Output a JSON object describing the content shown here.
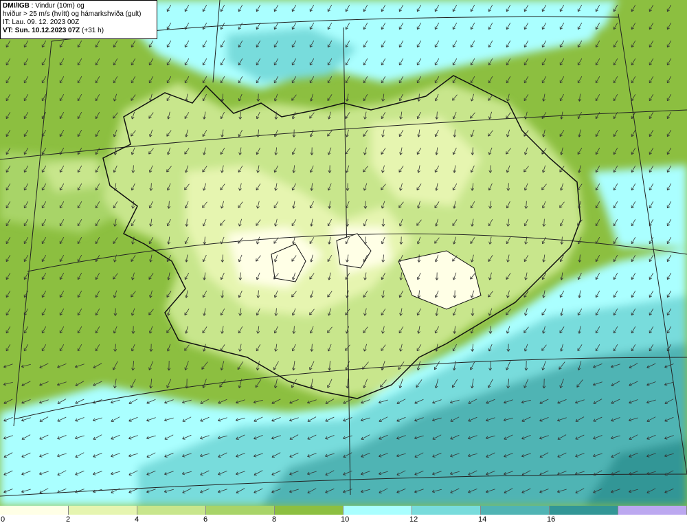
{
  "header": {
    "agency": "DMI/IGB",
    "title_rest": " : Vindur (10m) og",
    "line2": "hviður > 25 m/s (hvítt) og hámarkshviða (gult)",
    "line3": "IT: Lau. 09. 12. 2023 00Z",
    "line4_bold": "VT: Sun. 10.12.2023 07Z",
    "line4_rest": " (+31 h)"
  },
  "colorbar": {
    "colors": [
      "#ffffe6",
      "#e6f5b0",
      "#c8e68c",
      "#a8d468",
      "#8cbf40",
      "#aaffff",
      "#78dcdc",
      "#50b4b4",
      "#329696",
      "#bca8f0"
    ],
    "ticks": [
      "0",
      "2",
      "4",
      "6",
      "8",
      "10",
      "12",
      "14",
      "16"
    ]
  },
  "map": {
    "wind_direction": "north-northeast",
    "layers": [
      "wind-speed-shading",
      "wind-arrows",
      "coastline",
      "grid-lines",
      "glaciers"
    ]
  }
}
